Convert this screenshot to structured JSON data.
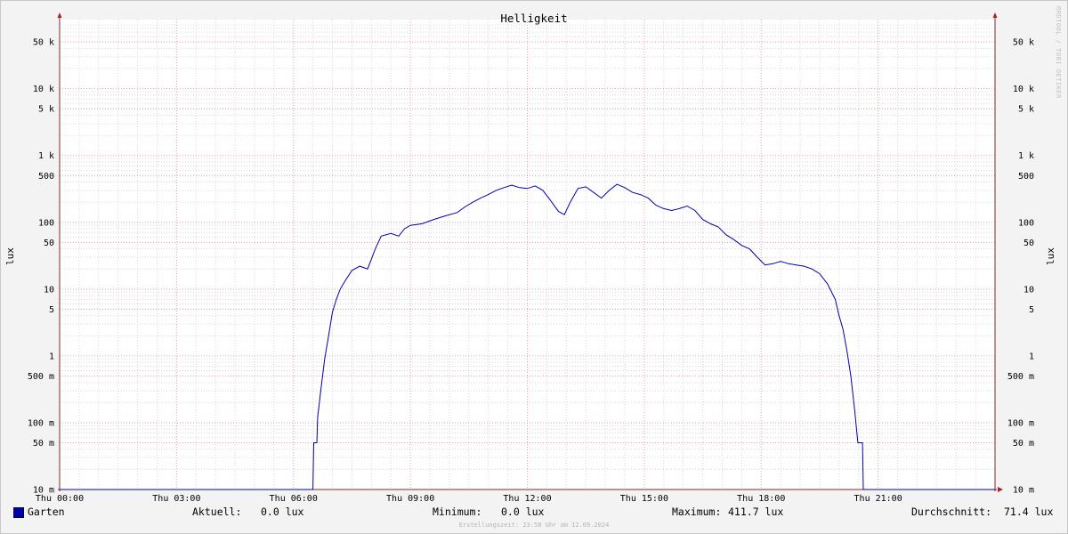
{
  "chart_data": {
    "type": "line",
    "title": "Helligkeit",
    "ylabel": "lux",
    "y_scale": "log",
    "ylim": [
      0.01,
      90000
    ],
    "xlim_hours": [
      0,
      24
    ],
    "x_ticks": [
      {
        "label": "Thu 00:00",
        "hour": 0
      },
      {
        "label": "Thu 03:00",
        "hour": 3
      },
      {
        "label": "Thu 06:00",
        "hour": 6
      },
      {
        "label": "Thu 09:00",
        "hour": 9
      },
      {
        "label": "Thu 12:00",
        "hour": 12
      },
      {
        "label": "Thu 15:00",
        "hour": 15
      },
      {
        "label": "Thu 18:00",
        "hour": 18
      },
      {
        "label": "Thu 21:00",
        "hour": 21
      }
    ],
    "y_ticks": [
      {
        "label": "10 m",
        "value": 0.01
      },
      {
        "label": "50 m",
        "value": 0.05
      },
      {
        "label": "100 m",
        "value": 0.1
      },
      {
        "label": "500 m",
        "value": 0.5
      },
      {
        "label": "1",
        "value": 1
      },
      {
        "label": "5",
        "value": 5
      },
      {
        "label": "10",
        "value": 10
      },
      {
        "label": "50",
        "value": 50
      },
      {
        "label": "100",
        "value": 100
      },
      {
        "label": "500",
        "value": 500
      },
      {
        "label": "1 k",
        "value": 1000
      },
      {
        "label": "5 k",
        "value": 5000
      },
      {
        "label": "10 k",
        "value": 10000
      },
      {
        "label": "50 k",
        "value": 50000
      }
    ],
    "grid": true,
    "series": [
      {
        "name": "Garten",
        "color": "#0000aa",
        "points": [
          [
            0,
            0.01
          ],
          [
            6.5,
            0.01
          ],
          [
            6.52,
            0.05
          ],
          [
            6.6,
            0.05
          ],
          [
            6.62,
            0.12
          ],
          [
            6.7,
            0.3
          ],
          [
            6.8,
            0.9
          ],
          [
            6.9,
            2
          ],
          [
            7.0,
            4.5
          ],
          [
            7.1,
            7
          ],
          [
            7.2,
            10
          ],
          [
            7.35,
            14
          ],
          [
            7.5,
            19
          ],
          [
            7.7,
            22
          ],
          [
            7.9,
            20
          ],
          [
            8.0,
            28
          ],
          [
            8.1,
            40
          ],
          [
            8.25,
            62
          ],
          [
            8.5,
            68
          ],
          [
            8.7,
            62
          ],
          [
            8.85,
            80
          ],
          [
            9.0,
            90
          ],
          [
            9.3,
            95
          ],
          [
            9.6,
            110
          ],
          [
            9.9,
            125
          ],
          [
            10.2,
            140
          ],
          [
            10.4,
            170
          ],
          [
            10.6,
            200
          ],
          [
            10.8,
            230
          ],
          [
            11.0,
            260
          ],
          [
            11.2,
            300
          ],
          [
            11.4,
            330
          ],
          [
            11.6,
            360
          ],
          [
            11.8,
            330
          ],
          [
            12.0,
            320
          ],
          [
            12.2,
            350
          ],
          [
            12.4,
            300
          ],
          [
            12.6,
            210
          ],
          [
            12.8,
            145
          ],
          [
            12.95,
            130
          ],
          [
            13.1,
            200
          ],
          [
            13.3,
            320
          ],
          [
            13.5,
            340
          ],
          [
            13.7,
            280
          ],
          [
            13.9,
            230
          ],
          [
            14.1,
            300
          ],
          [
            14.3,
            370
          ],
          [
            14.5,
            330
          ],
          [
            14.7,
            280
          ],
          [
            14.9,
            260
          ],
          [
            15.1,
            230
          ],
          [
            15.3,
            180
          ],
          [
            15.5,
            160
          ],
          [
            15.7,
            150
          ],
          [
            15.9,
            160
          ],
          [
            16.1,
            175
          ],
          [
            16.3,
            150
          ],
          [
            16.5,
            110
          ],
          [
            16.7,
            95
          ],
          [
            16.9,
            85
          ],
          [
            17.1,
            65
          ],
          [
            17.3,
            55
          ],
          [
            17.5,
            45
          ],
          [
            17.7,
            40
          ],
          [
            17.9,
            30
          ],
          [
            18.1,
            23
          ],
          [
            18.3,
            24
          ],
          [
            18.5,
            26
          ],
          [
            18.7,
            24
          ],
          [
            18.9,
            23
          ],
          [
            19.1,
            22
          ],
          [
            19.3,
            20
          ],
          [
            19.5,
            17
          ],
          [
            19.7,
            12
          ],
          [
            19.9,
            7
          ],
          [
            20.0,
            4
          ],
          [
            20.1,
            2.5
          ],
          [
            20.2,
            1.2
          ],
          [
            20.3,
            0.5
          ],
          [
            20.4,
            0.15
          ],
          [
            20.48,
            0.05
          ],
          [
            20.6,
            0.05
          ],
          [
            20.62,
            0.01
          ],
          [
            24,
            0.01
          ]
        ]
      }
    ]
  },
  "legend": {
    "series_name": "Garten",
    "current_label": "Aktuell:",
    "current_value": "0.0 lux",
    "min_label": "Minimum:",
    "min_value": "0.0 lux",
    "max_label": "Maximum:",
    "max_value": "411.7 lux",
    "avg_label": "Durchschnitt:",
    "avg_value": "71.4 lux"
  },
  "footer": "Erstellungszeit: 23:58 Uhr am 12.09.2024",
  "watermark": "RRDTOOL / TOBI OETIKER"
}
